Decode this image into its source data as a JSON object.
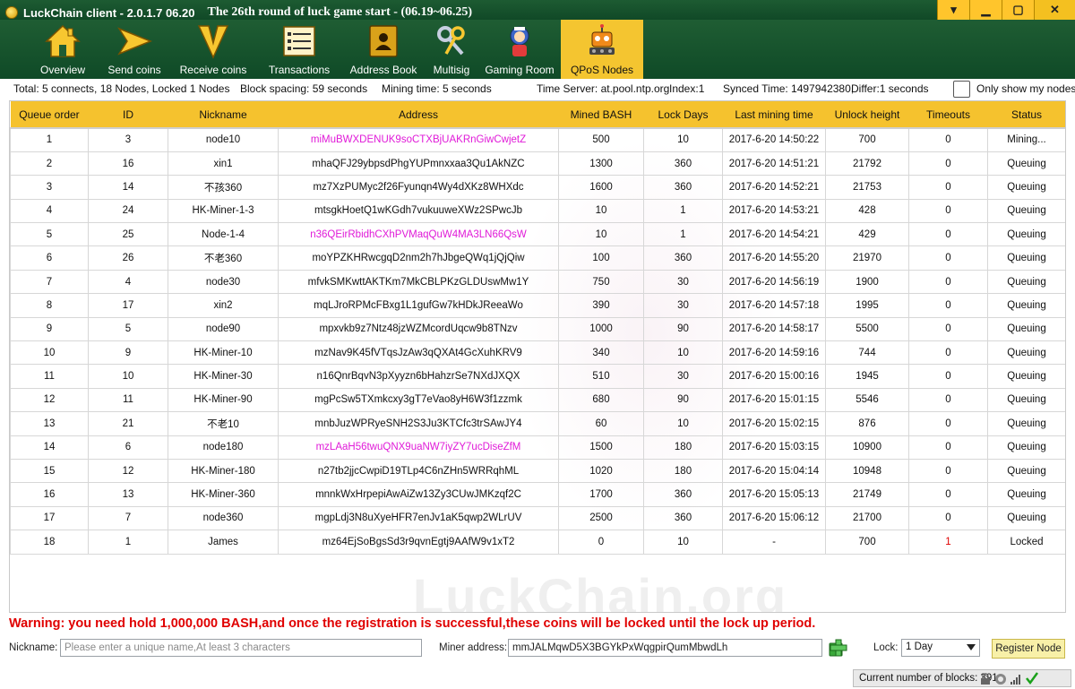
{
  "window": {
    "app_title": "LuckChain client - 2.0.1.7 06.20",
    "round_title": "The 26th round of luck game start - (06.19~06.25)",
    "controls": {
      "dropdown": "▾",
      "minimize": "▁",
      "maximize": "▢",
      "close": "✕"
    }
  },
  "toolbar": {
    "items": [
      {
        "label": "Overview",
        "icon": "house-icon"
      },
      {
        "label": "Send coins",
        "icon": "send-arrow-icon"
      },
      {
        "label": "Receive coins",
        "icon": "receive-v-icon"
      },
      {
        "label": "Transactions",
        "icon": "list-icon"
      },
      {
        "label": "Address Book",
        "icon": "address-book-icon"
      },
      {
        "label": "Multisig",
        "icon": "keys-icon"
      },
      {
        "label": "Gaming Room",
        "icon": "mascot-icon"
      },
      {
        "label": "QPoS Nodes",
        "icon": "robot-icon",
        "active": true
      }
    ]
  },
  "info": {
    "total": "Total:  5 connects,  18 Nodes, Locked 1 Nodes",
    "block_spacing": "Block spacing:  59 seconds",
    "mining_time": "Mining time:  5 seconds",
    "time_server": "Time Server:  at.pool.ntp.org",
    "index": "Index:1",
    "synced_time": "Synced Time:  1497942380,",
    "differ": "Differ:1 seconds",
    "only_show_my_nodes": "Only show my nodes"
  },
  "table": {
    "columns": [
      "Queue order",
      "ID",
      "Nickname",
      "Address",
      "Mined BASH",
      "Lock Days",
      "Last mining time",
      "Unlock height",
      "Timeouts",
      "Status"
    ],
    "rows": [
      [
        "1",
        "3",
        "node10",
        "miMuBWXDENUK9soCTXBjUAKRnGiwCwjetZ",
        "500",
        "10",
        "2017-6-20 14:50:22",
        "700",
        "0",
        "Mining..."
      ],
      [
        "2",
        "16",
        "xin1",
        "mhaQFJ29ybpsdPhgYUPmnxxaa3Qu1AkNZC",
        "1300",
        "360",
        "2017-6-20 14:51:21",
        "21792",
        "0",
        "Queuing"
      ],
      [
        "3",
        "14",
        "不孩360",
        "mz7XzPUMyc2f26Fyunqn4Wy4dXKz8WHXdc",
        "1600",
        "360",
        "2017-6-20 14:52:21",
        "21753",
        "0",
        "Queuing"
      ],
      [
        "4",
        "24",
        "HK-Miner-1-3",
        "mtsgkHoetQ1wKGdh7vukuuweXWz2SPwcJb",
        "10",
        "1",
        "2017-6-20 14:53:21",
        "428",
        "0",
        "Queuing"
      ],
      [
        "5",
        "25",
        "Node-1-4",
        "n36QEirRbidhCXhPVMaqQuW4MA3LN66QsW",
        "10",
        "1",
        "2017-6-20 14:54:21",
        "429",
        "0",
        "Queuing"
      ],
      [
        "6",
        "26",
        "不老360",
        "moYPZKHRwcgqD2nm2h7hJbgeQWq1jQjQiw",
        "100",
        "360",
        "2017-6-20 14:55:20",
        "21970",
        "0",
        "Queuing"
      ],
      [
        "7",
        "4",
        "node30",
        "mfvkSMKwttAKTKm7MkCBLPKzGLDUswMw1Y",
        "750",
        "30",
        "2017-6-20 14:56:19",
        "1900",
        "0",
        "Queuing"
      ],
      [
        "8",
        "17",
        "xin2",
        "mqLJroRPMcFBxg1L1gufGw7kHDkJReeaWo",
        "390",
        "30",
        "2017-6-20 14:57:18",
        "1995",
        "0",
        "Queuing"
      ],
      [
        "9",
        "5",
        "node90",
        "mpxvkb9z7Ntz48jzWZMcordUqcw9b8TNzv",
        "1000",
        "90",
        "2017-6-20 14:58:17",
        "5500",
        "0",
        "Queuing"
      ],
      [
        "10",
        "9",
        "HK-Miner-10",
        "mzNav9K45fVTqsJzAw3qQXAt4GcXuhKRV9",
        "340",
        "10",
        "2017-6-20 14:59:16",
        "744",
        "0",
        "Queuing"
      ],
      [
        "11",
        "10",
        "HK-Miner-30",
        "n16QnrBqvN3pXyyzn6bHahzrSe7NXdJXQX",
        "510",
        "30",
        "2017-6-20 15:00:16",
        "1945",
        "0",
        "Queuing"
      ],
      [
        "12",
        "11",
        "HK-Miner-90",
        "mgPcSw5TXmkcxy3gT7eVao8yH6W3f1zzmk",
        "680",
        "90",
        "2017-6-20 15:01:15",
        "5546",
        "0",
        "Queuing"
      ],
      [
        "13",
        "21",
        "不老10",
        "mnbJuzWPRyeSNH2S3Ju3KTCfc3trSAwJY4",
        "60",
        "10",
        "2017-6-20 15:02:15",
        "876",
        "0",
        "Queuing"
      ],
      [
        "14",
        "6",
        "node180",
        "mzLAaH56twuQNX9uaNW7iyZY7ucDiseZfM",
        "1500",
        "180",
        "2017-6-20 15:03:15",
        "10900",
        "0",
        "Queuing"
      ],
      [
        "15",
        "12",
        "HK-Miner-180",
        "n27tb2jjcCwpiD19TLp4C6nZHn5WRRqhML",
        "1020",
        "180",
        "2017-6-20 15:04:14",
        "10948",
        "0",
        "Queuing"
      ],
      [
        "16",
        "13",
        "HK-Miner-360",
        "mnnkWxHrpepiAwAiZw13Zy3CUwJMKzqf2C",
        "1700",
        "360",
        "2017-6-20 15:05:13",
        "21749",
        "0",
        "Queuing"
      ],
      [
        "17",
        "7",
        "node360",
        "mgpLdj3N8uXyeHFR7enJv1aK5qwp2WLrUV",
        "2500",
        "360",
        "2017-6-20 15:06:12",
        "21700",
        "0",
        "Queuing"
      ],
      [
        "18",
        "1",
        "James",
        "mz64EjSoBgsSd3r9qvnEgtj9AAfW9v1xT2",
        "0",
        "10",
        "-",
        "700",
        "1",
        "Locked"
      ]
    ],
    "pink_address_rows": [
      0,
      4,
      13
    ],
    "red_timeout_rows": [
      17
    ],
    "watermark": "LuckChain.org"
  },
  "warning": "Warning: you need hold 1,000,000 BASH,and once the registration is successful,these coins will be locked until the lock up period.",
  "form": {
    "nickname_label": "Nickname:",
    "nickname_placeholder": "Please enter a unique name,At least 3 characters",
    "miner_address_label": "Miner address:",
    "miner_address_value": "mmJALMqwD5X3BGYkPxWqgpirQumMbwdLh",
    "lock_label": "Lock:",
    "lock_value": "1 Day",
    "register_button": "Register Node"
  },
  "status": {
    "blocks": "Current number of blocks: 391"
  },
  "colors": {
    "dark_green": "#0f4a27",
    "header_yellow": "#f5c22e",
    "warning_red": "#e00000",
    "address_pink": "#e01ad8"
  }
}
